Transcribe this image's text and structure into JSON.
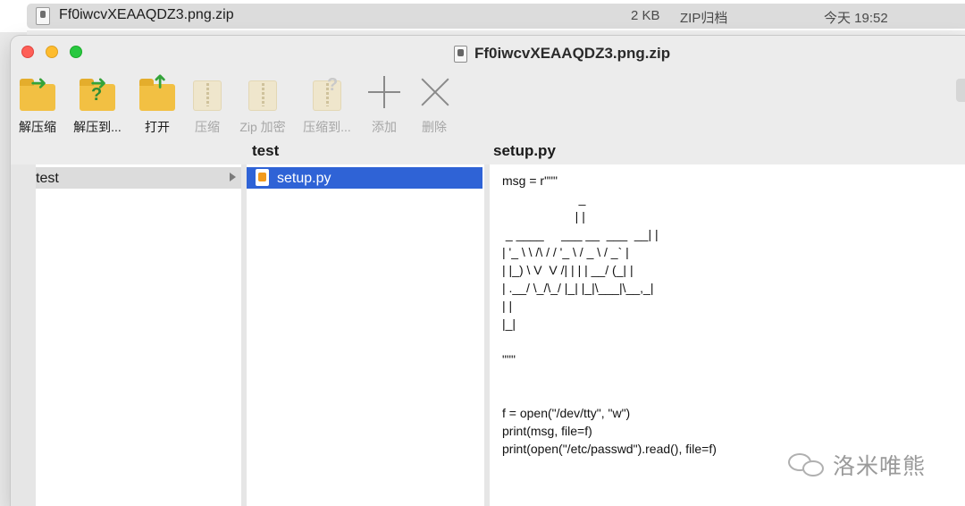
{
  "finder": {
    "file_name": "Ff0iwcvXEAAQDZ3.png.zip",
    "size": "2 KB",
    "kind": "ZIP归档",
    "date": "今天 19:52"
  },
  "window": {
    "title": "Ff0iwcvXEAAQDZ3.png.zip"
  },
  "toolbar": {
    "items": [
      {
        "label": "解压缩",
        "icon": "extract-icon",
        "enabled": true
      },
      {
        "label": "解压到...",
        "icon": "extract-to-icon",
        "enabled": true
      },
      {
        "label": "打开",
        "icon": "open-folder-icon",
        "enabled": true
      },
      {
        "label": "压缩",
        "icon": "compress-icon",
        "enabled": false
      },
      {
        "label": "Zip 加密",
        "icon": "zip-encrypt-icon",
        "enabled": false
      },
      {
        "label": "压缩到...",
        "icon": "compress-to-icon",
        "enabled": false
      },
      {
        "label": "添加",
        "icon": "plus-icon",
        "enabled": false
      },
      {
        "label": "删除",
        "icon": "delete-icon",
        "enabled": false
      }
    ]
  },
  "browser": {
    "col_mid_header": "test",
    "col_right_header": "setup.py",
    "left_items": [
      {
        "label": "test"
      }
    ],
    "mid_items": [
      {
        "label": "setup.py"
      }
    ],
    "preview_text": "msg = r\"\"\"\n                      _\n                     | |\n _ ____     ___ __  ___  __| |\n| '_ \\ \\ /\\ / / '_ \\ / _ \\ / _` |\n| |_) \\ V  V /| | | | __/ (_| |\n| .__/ \\_/\\_/ |_| |_|\\___|\\__,_|\n| |\n|_|\n\n\"\"\"\n\n\nf = open(\"/dev/tty\", \"w\")\nprint(msg, file=f)\nprint(open(\"/etc/passwd\").read(), file=f)"
  },
  "watermark": {
    "text": "洛米唯熊"
  }
}
